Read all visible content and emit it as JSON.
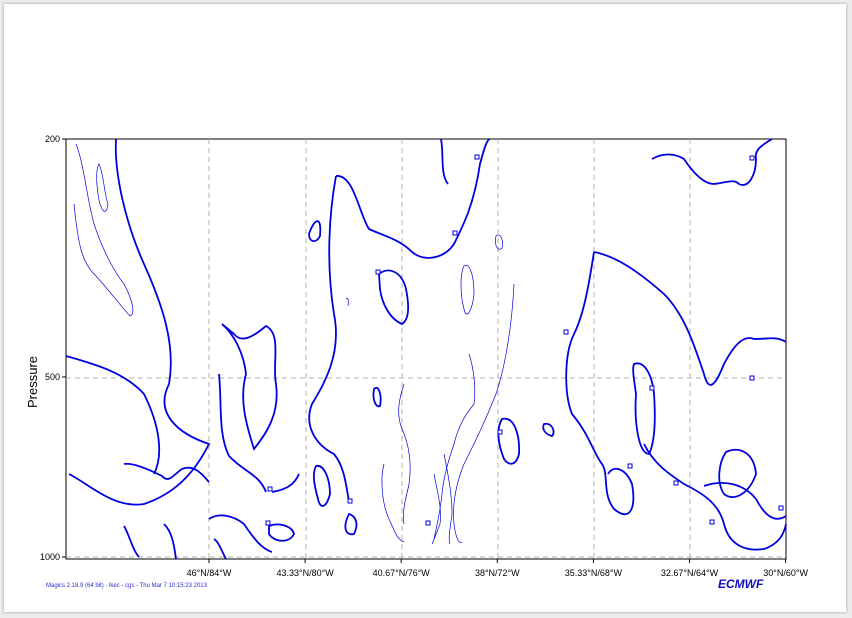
{
  "chart_data": {
    "type": "contour",
    "title": "",
    "ylabel": "Pressure",
    "xlabel": "",
    "y_scale": "log",
    "ylim": [
      1000,
      200
    ],
    "y_ticks": [
      "200",
      "500",
      "1000"
    ],
    "x_ticks": [
      "46°N/84°W",
      "43.33°N/80°W",
      "40.67°N/76°W",
      "38°N/72°W",
      "35.33°N/68°W",
      "32.67°N/64°W",
      "30°N/60°W"
    ],
    "grid": true,
    "contour_color": "#0000e0"
  },
  "footer": {
    "credit": "Magics 2.18.9 (64 bit) - lkec - cgs - Thu Mar  7 10:15:23 2013",
    "logo": "ECMWF"
  }
}
